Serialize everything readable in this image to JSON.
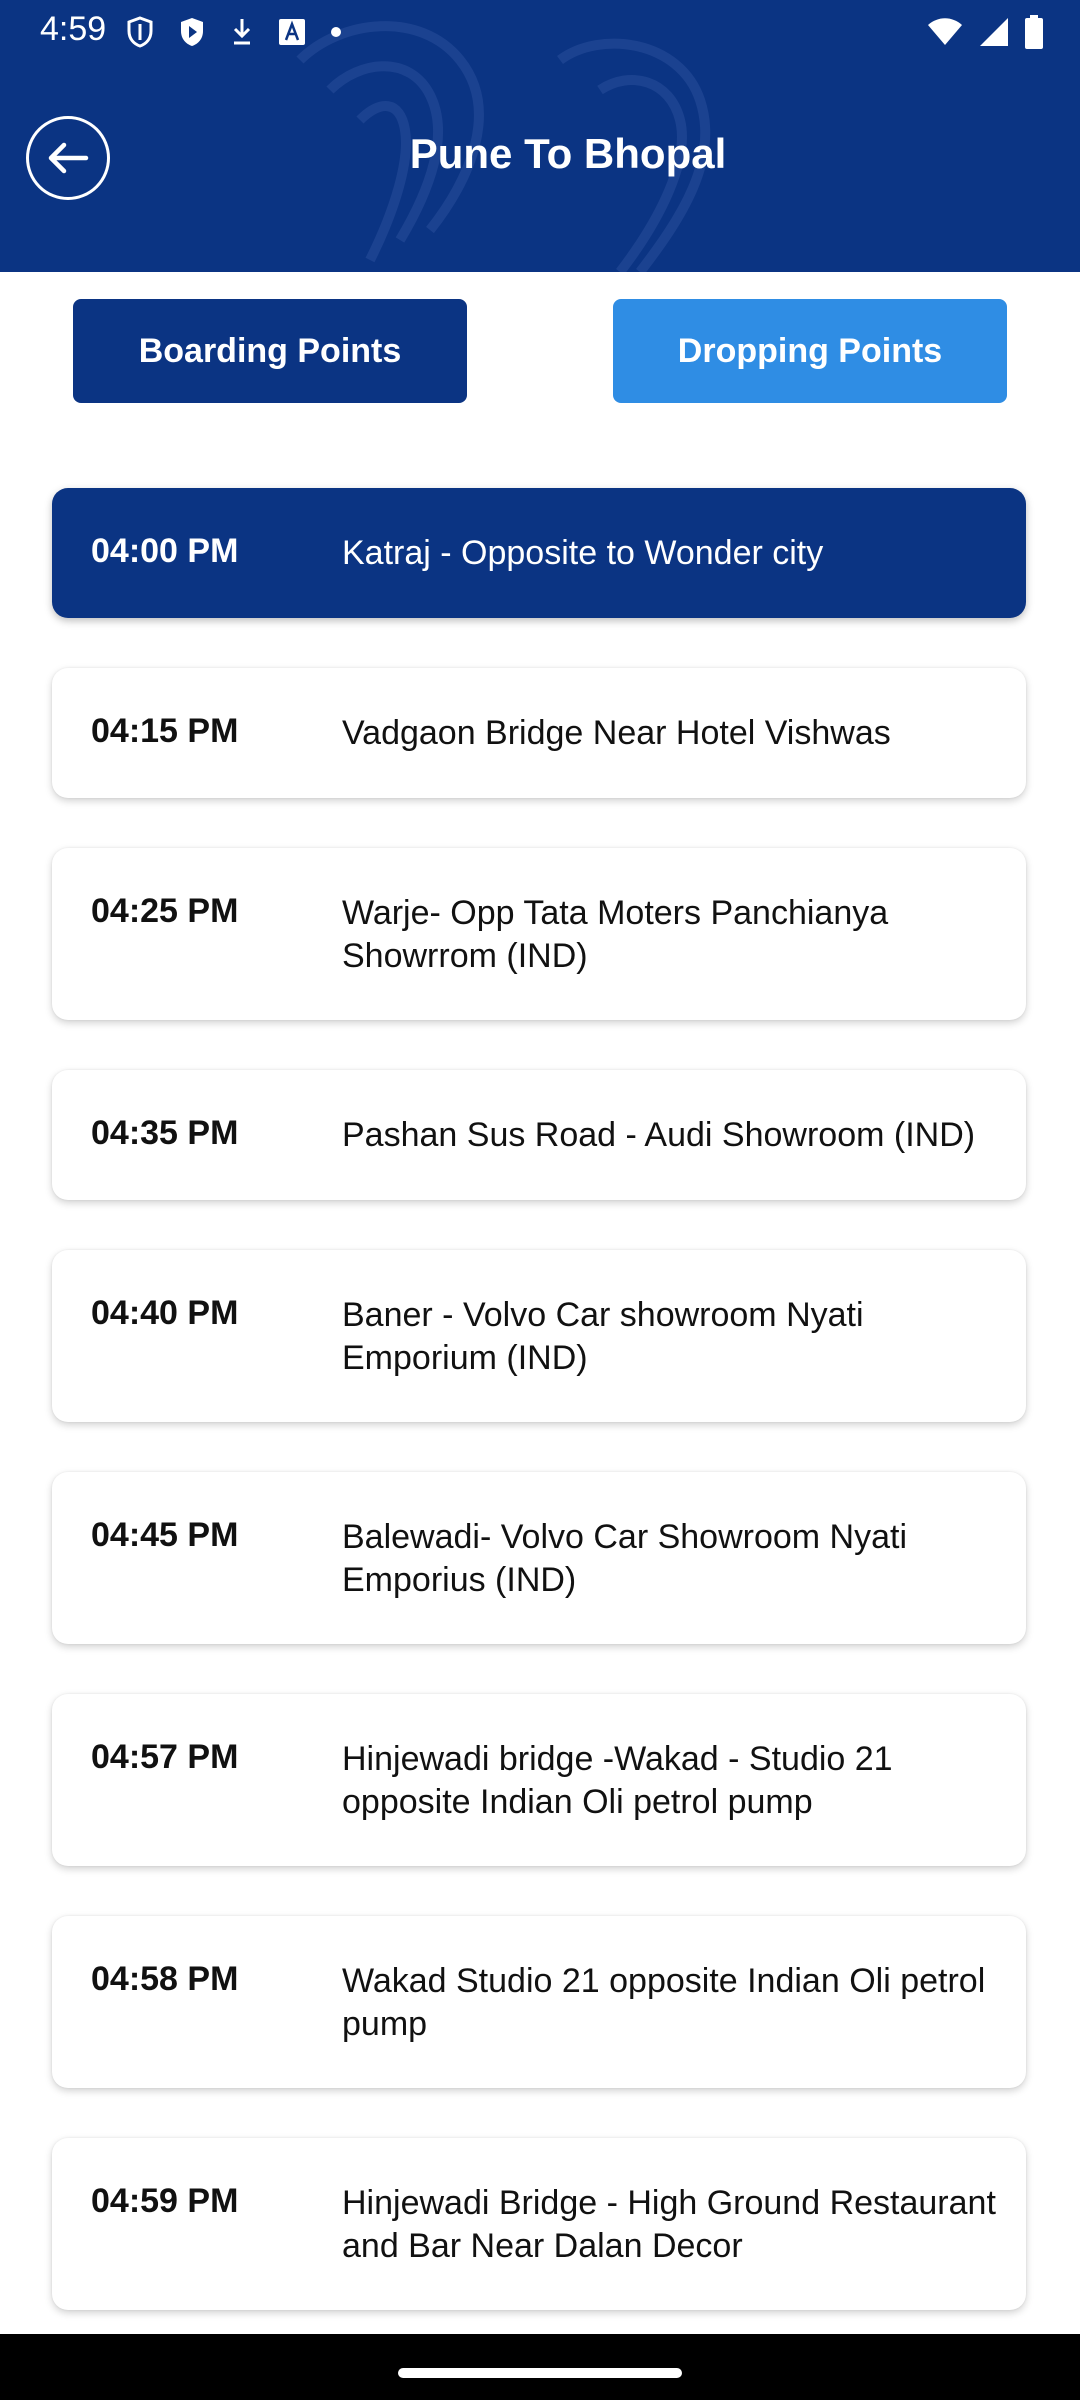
{
  "status_bar": {
    "time": "4:59",
    "icons": [
      "shield-icon",
      "play-shield-icon",
      "download-icon",
      "text-a-icon",
      "dot-icon",
      "wifi-icon",
      "signal-icon",
      "battery-icon"
    ]
  },
  "header": {
    "title": "Pune To Bhopal",
    "back_icon": "back-arrow-icon",
    "background_color": "#0b3483"
  },
  "tabs": {
    "boarding_label": "Boarding Points",
    "dropping_label": "Dropping Points",
    "boarding_color": "#0b3483",
    "dropping_color": "#2f8de4"
  },
  "stops": [
    {
      "time": "04:00 PM",
      "name": "Katraj - Opposite to Wonder city",
      "selected": true
    },
    {
      "time": "04:15 PM",
      "name": "Vadgaon Bridge Near Hotel Vishwas",
      "selected": false
    },
    {
      "time": "04:25 PM",
      "name": "Warje- Opp Tata Moters Panchianya Showrrom (IND)",
      "selected": false
    },
    {
      "time": "04:35 PM",
      "name": "Pashan Sus Road - Audi Showroom (IND)",
      "selected": false
    },
    {
      "time": "04:40 PM",
      "name": "Baner - Volvo Car showroom Nyati Emporium (IND)",
      "selected": false
    },
    {
      "time": "04:45 PM",
      "name": "Balewadi- Volvo Car Showroom Nyati Emporius (IND)",
      "selected": false
    },
    {
      "time": "04:57 PM",
      "name": "Hinjewadi bridge -Wakad - Studio 21 opposite Indian Oli petrol pump",
      "selected": false
    },
    {
      "time": "04:58 PM",
      "name": "Wakad Studio 21 opposite Indian Oli petrol pump",
      "selected": false
    },
    {
      "time": "04:59 PM",
      "name": "Hinjewadi Bridge - High Ground Restaurant and Bar Near Dalan Decor",
      "selected": false
    }
  ]
}
